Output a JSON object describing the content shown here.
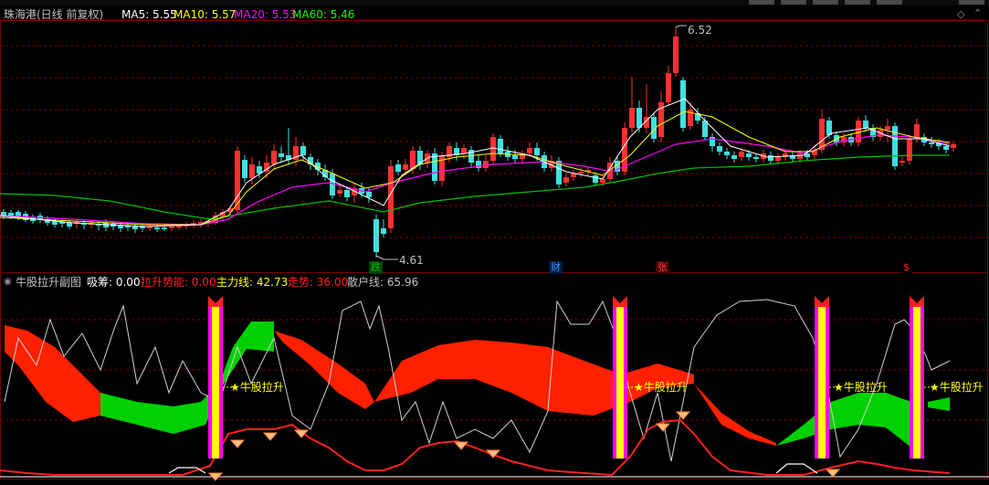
{
  "main_panel": {
    "title": "珠海港(日线 前复权)",
    "ma_items": [
      {
        "label": "MA5: 5.55",
        "color": "#ffffff"
      },
      {
        "label": "MA10: 5.57",
        "color": "#ffff00"
      },
      {
        "label": "MA20: 5.53",
        "color": "#ff00ff"
      },
      {
        "label": "MA60: 5.46",
        "color": "#00ff00"
      }
    ],
    "high_marker": "6.52",
    "low_marker": "4.61",
    "corner_icons": [
      "diamond-icon",
      "chevron-up-icon"
    ],
    "event_markers": [
      {
        "text": "跌",
        "color": "#00c000",
        "bg": "#004400"
      },
      {
        "text": "财",
        "color": "#4090ff",
        "bg": "#001a40"
      },
      {
        "text": "张",
        "color": "#ff4040",
        "bg": "#400000"
      },
      {
        "text": "$",
        "color": "#ff2020",
        "bg": "#000000"
      }
    ]
  },
  "sub_panel": {
    "title": "牛股拉升副图",
    "indicators": [
      {
        "label": "吸筹: 0.00",
        "color": "#ffffff"
      },
      {
        "label": "拉升势能: 0.00",
        "color": "#ff2020"
      },
      {
        "label": "主力线: 42.73",
        "color": "#ffff00"
      },
      {
        "label": "走势: 36.00",
        "color": "#ff2020"
      },
      {
        "label": "散户线: 65.96",
        "color": "#c0c0c0"
      }
    ],
    "signal_label": "★牛股拉升"
  },
  "colors": {
    "background": "#000000",
    "up_candle": "#ff3030",
    "down_candle": "#40e0e0",
    "grid": "#7a0000",
    "green_band": "#00d000",
    "red_band": "#ff2000"
  }
}
